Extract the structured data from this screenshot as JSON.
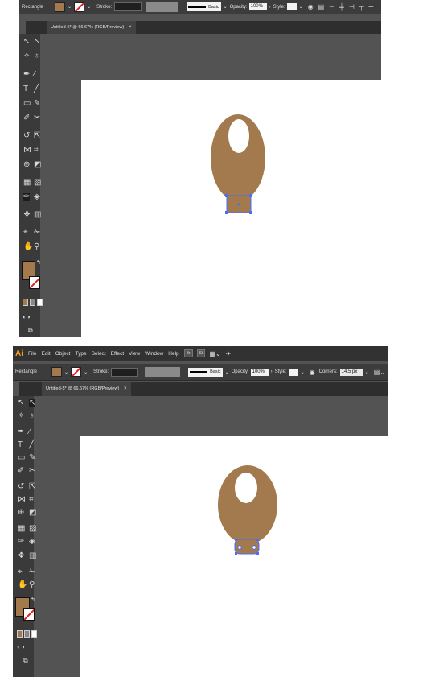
{
  "menu": {
    "app_logo": "Ai",
    "items": [
      "File",
      "Edit",
      "Object",
      "Type",
      "Select",
      "Effect",
      "View",
      "Window",
      "Help"
    ],
    "bridge": "Br",
    "stock": "St"
  },
  "control_bar": {
    "tool_label": "Rectangle",
    "stroke_label": "Stroke:",
    "brush_label": "Basic",
    "opacity_label": "Opacity:",
    "opacity_value": "100%",
    "style_label": "Style:",
    "corners_label": "Corners:",
    "corners_value": "14.5 px"
  },
  "document": {
    "tab_title": "Untitled-5* @ 66.67% (RGB/Preview)",
    "close_glyph": "×"
  },
  "colors": {
    "fill": "#a37a4e",
    "selection": "#4a6cff",
    "ui_dark": "#535353"
  },
  "icons": [
    "selection-tool-icon",
    "direct-selection-tool-icon",
    "magic-wand-icon",
    "lasso-icon",
    "pen-icon",
    "type-icon",
    "line-icon",
    "rectangle-icon",
    "paintbrush-icon",
    "shaper-icon",
    "scissors-icon",
    "rotate-icon",
    "scale-icon",
    "width-icon",
    "free-transform-icon",
    "shape-builder-icon",
    "perspective-icon",
    "mesh-icon",
    "gradient-icon",
    "eyedropper-icon",
    "blend-icon",
    "symbol-sprayer-icon",
    "graph-icon",
    "artboard-icon",
    "slice-icon",
    "hand-icon",
    "zoom-icon"
  ]
}
